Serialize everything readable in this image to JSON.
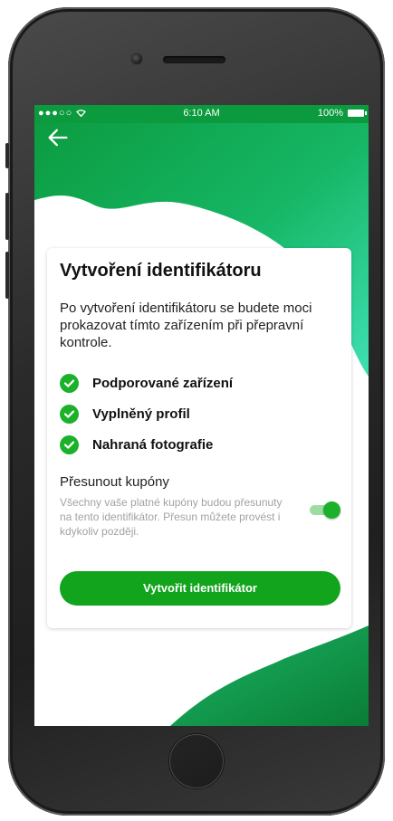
{
  "status_bar": {
    "signal": "●●●○○",
    "wifi_icon": "wifi-icon",
    "time": "6:10 AM",
    "battery": "100%"
  },
  "header": {
    "back_icon": "arrow-left-icon"
  },
  "colors": {
    "brand_green": "#0b9a3e",
    "accent_green": "#12a41c",
    "check_green": "#1bb12a"
  },
  "card": {
    "title": "Vytvoření identifikátoru",
    "description": "Po vytvoření identifikátoru se budete moci prokazovat tímto zařízením při přepravní kontrole.",
    "requirements": [
      {
        "label": "Podporované zařízení",
        "icon": "check-circle-icon"
      },
      {
        "label": "Vyplněný profil",
        "icon": "check-circle-icon"
      },
      {
        "label": "Nahraná fotografie",
        "icon": "check-circle-icon"
      }
    ],
    "move_coupons": {
      "title": "Přesunout kupóny",
      "description": "Všechny vaše platné kupóny budou přesunuty na tento identifikátor. Přesun můžete provést i kdykoliv později.",
      "enabled": true
    },
    "create_button": "Vytvořit identifikátor"
  }
}
